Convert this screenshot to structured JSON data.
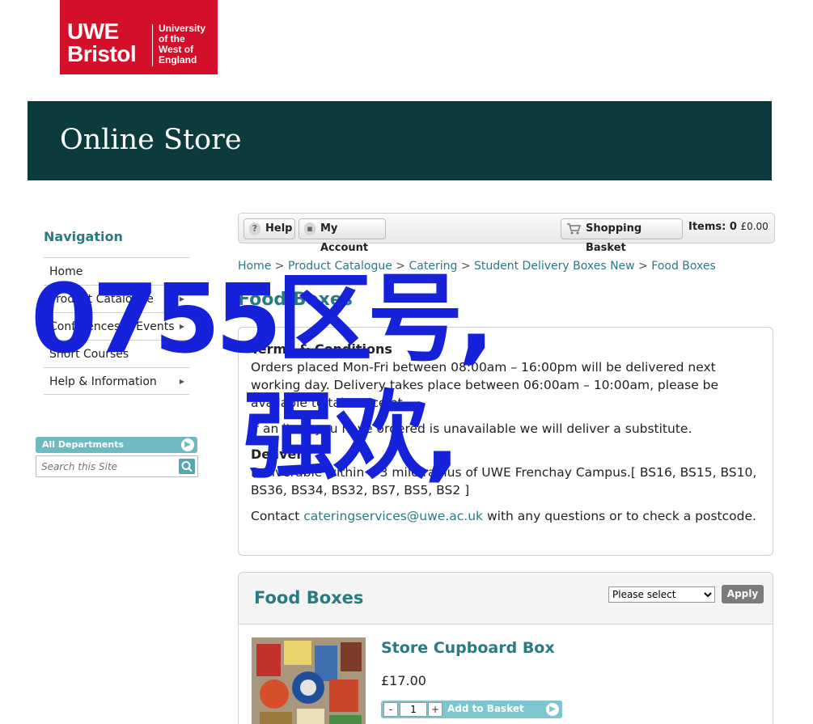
{
  "logo": {
    "line1": "UWE",
    "line2": "Bristol",
    "sub": [
      "University",
      "of the",
      "West of",
      "England"
    ]
  },
  "banner": {
    "title": "Online Store"
  },
  "nav": {
    "heading": "Navigation",
    "items": [
      {
        "label": "Home",
        "has_arrow": false
      },
      {
        "label": "Product Catalogue",
        "has_arrow": true
      },
      {
        "label": "Conferences & Events",
        "has_arrow": true
      },
      {
        "label": "Short Courses",
        "has_arrow": false
      },
      {
        "label": "Help & Information",
        "has_arrow": true
      }
    ]
  },
  "departments": {
    "label": "All Departments"
  },
  "search": {
    "placeholder": "Search this Site"
  },
  "toolbar": {
    "help": "Help",
    "account": "My Account",
    "basket": "Shopping Basket",
    "items_label": "Items: 0",
    "total": "£0.00"
  },
  "breadcrumb": [
    "Home",
    "Product Catalogue",
    "Catering",
    "Student Delivery Boxes New",
    "Food Boxes"
  ],
  "breadcrumb_sep": ">",
  "page_title": "Food Boxes",
  "terms": {
    "heading": "Terms & Conditions",
    "p1": "Orders placed Mon-Fri between 08:00am – 16:00pm will be delivered next working day. Delivery takes place between 06:00am – 10:00am, please be available to take receipt.",
    "p2": "If an item you have ordered is unavailable we will deliver a substitute.",
    "delivery_heading": "Delivery",
    "p3": "Deliverable within a 3 mile radius of UWE Frenchay Campus.[ BS16, BS15, BS10, BS36, BS34, BS32, BS7, BS5, BS2 ]",
    "contact_prefix": "Contact ",
    "contact_email": "cateringservices@uwe.ac.uk",
    "contact_suffix": " with any questions or to check a postcode."
  },
  "products_panel": {
    "title": "Food Boxes",
    "sort_selected": "Please select",
    "apply": "Apply"
  },
  "product": {
    "name": "Store Cupboard Box",
    "price": "£17.00",
    "qty": "1",
    "minus": "-",
    "plus": "+",
    "add_label": "Add to Basket"
  },
  "overlay": {
    "line1": "0755区号,",
    "line2": "强欢,"
  },
  "colors": {
    "brand_red": "#d40f2a",
    "banner": "#0b3b3d",
    "teal": "#2a7a84",
    "overlay_blue": "#1522d9"
  }
}
